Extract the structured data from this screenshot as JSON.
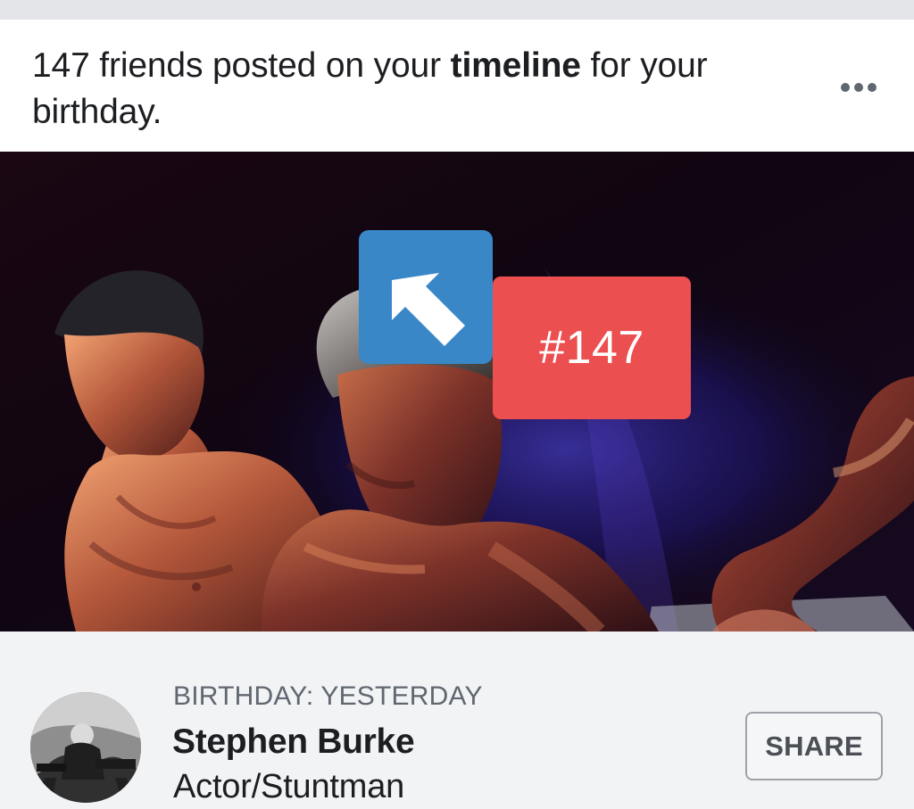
{
  "post": {
    "headline_prefix": "147 friends posted on your ",
    "headline_strong": "timeline",
    "headline_suffix": " for your birthday.",
    "more_icon": "more-options-icon"
  },
  "overlay": {
    "pointer_icon": "up-left-arrow-icon",
    "count_label": "#147",
    "pointer_color": "#3A87C8",
    "count_color": "#EC4F4F"
  },
  "profile": {
    "birthday_label": "BIRTHDAY: YESTERDAY",
    "name": "Stephen Burke",
    "role": "Actor/Stuntman",
    "share_label": "SHARE"
  }
}
